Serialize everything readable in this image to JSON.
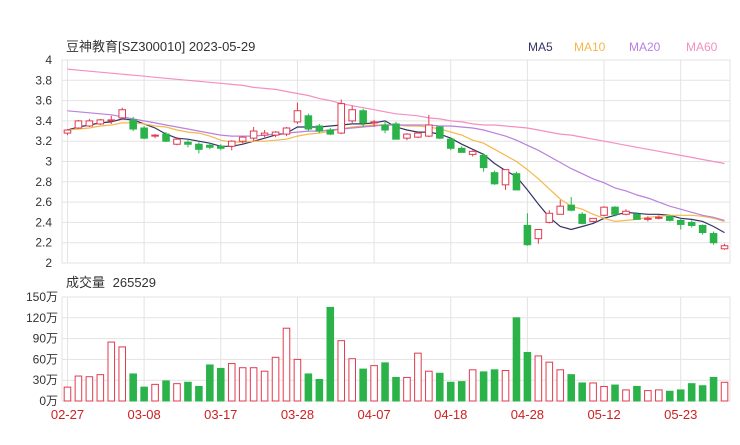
{
  "header": {
    "title": "豆神教育[SZ300010] 2023-05-29",
    "legend": [
      {
        "label": "MA5",
        "color": "#333366"
      },
      {
        "label": "MA10",
        "color": "#f5b84a"
      },
      {
        "label": "MA20",
        "color": "#b980e0"
      },
      {
        "label": "MA60",
        "color": "#f58fc0"
      }
    ]
  },
  "volume_header": {
    "label": "成交量",
    "value": "265529"
  },
  "colors": {
    "up": "#e03b4f",
    "down": "#2bb34a",
    "grid": "#e3e3e3",
    "axis": "#666666",
    "date": "#cc2222"
  },
  "chart_data": [
    {
      "type": "candlestick",
      "title": "豆神教育[SZ300010] 2023-05-29",
      "ylim": [
        2,
        4
      ],
      "y_ticks": [
        "4",
        "3.8",
        "3.6",
        "3.4",
        "3.2",
        "3",
        "2.8",
        "2.6",
        "2.4",
        "2.2",
        "2"
      ],
      "x_tick_labels": [
        "02-27",
        "03-08",
        "03-17",
        "03-28",
        "04-07",
        "04-18",
        "04-28",
        "05-12",
        "05-23"
      ],
      "x_tick_indices": [
        0,
        7,
        14,
        21,
        28,
        35,
        42,
        49,
        56
      ],
      "ohlc": [
        [
          3.28,
          3.32,
          3.26,
          3.31
        ],
        [
          3.33,
          3.41,
          3.32,
          3.4
        ],
        [
          3.35,
          3.42,
          3.34,
          3.4
        ],
        [
          3.37,
          3.42,
          3.36,
          3.41
        ],
        [
          3.4,
          3.45,
          3.37,
          3.41
        ],
        [
          3.43,
          3.53,
          3.41,
          3.51
        ],
        [
          3.41,
          3.44,
          3.3,
          3.32
        ],
        [
          3.33,
          3.35,
          3.22,
          3.23
        ],
        [
          3.25,
          3.27,
          3.23,
          3.26
        ],
        [
          3.27,
          3.29,
          3.19,
          3.2
        ],
        [
          3.17,
          3.24,
          3.16,
          3.22
        ],
        [
          3.19,
          3.21,
          3.14,
          3.17
        ],
        [
          3.17,
          3.19,
          3.08,
          3.12
        ],
        [
          3.16,
          3.18,
          3.12,
          3.14
        ],
        [
          3.15,
          3.17,
          3.11,
          3.13
        ],
        [
          3.15,
          3.21,
          3.11,
          3.2
        ],
        [
          3.2,
          3.25,
          3.18,
          3.24
        ],
        [
          3.23,
          3.34,
          3.2,
          3.3
        ],
        [
          3.26,
          3.31,
          3.24,
          3.28
        ],
        [
          3.26,
          3.3,
          3.24,
          3.29
        ],
        [
          3.27,
          3.34,
          3.25,
          3.33
        ],
        [
          3.39,
          3.58,
          3.37,
          3.5
        ],
        [
          3.45,
          3.47,
          3.3,
          3.32
        ],
        [
          3.35,
          3.37,
          3.28,
          3.3
        ],
        [
          3.31,
          3.33,
          3.26,
          3.27
        ],
        [
          3.28,
          3.61,
          3.27,
          3.57
        ],
        [
          3.4,
          3.55,
          3.38,
          3.51
        ],
        [
          3.5,
          3.52,
          3.34,
          3.38
        ],
        [
          3.38,
          3.41,
          3.34,
          3.39
        ],
        [
          3.36,
          3.4,
          3.28,
          3.31
        ],
        [
          3.37,
          3.39,
          3.22,
          3.22
        ],
        [
          3.23,
          3.28,
          3.21,
          3.27
        ],
        [
          3.24,
          3.29,
          3.23,
          3.28
        ],
        [
          3.25,
          3.46,
          3.24,
          3.36
        ],
        [
          3.34,
          3.35,
          3.22,
          3.23
        ],
        [
          3.22,
          3.24,
          3.11,
          3.13
        ],
        [
          3.13,
          3.15,
          3.09,
          3.09
        ],
        [
          3.07,
          3.11,
          3.05,
          3.1
        ],
        [
          3.06,
          3.08,
          2.9,
          2.94
        ],
        [
          2.89,
          2.91,
          2.77,
          2.78
        ],
        [
          2.77,
          2.9,
          2.72,
          2.92
        ],
        [
          2.88,
          2.9,
          2.72,
          2.72
        ],
        [
          2.37,
          2.49,
          2.17,
          2.18
        ],
        [
          2.24,
          2.32,
          2.19,
          2.33
        ],
        [
          2.4,
          2.52,
          2.39,
          2.49
        ],
        [
          2.48,
          2.62,
          2.48,
          2.56
        ],
        [
          2.57,
          2.65,
          2.51,
          2.52
        ],
        [
          2.48,
          2.5,
          2.38,
          2.39
        ],
        [
          2.41,
          2.44,
          2.4,
          2.44
        ],
        [
          2.47,
          2.56,
          2.46,
          2.55
        ],
        [
          2.55,
          2.56,
          2.46,
          2.48
        ],
        [
          2.48,
          2.53,
          2.47,
          2.51
        ],
        [
          2.48,
          2.5,
          2.43,
          2.43
        ],
        [
          2.43,
          2.46,
          2.41,
          2.44
        ],
        [
          2.45,
          2.47,
          2.43,
          2.45
        ],
        [
          2.46,
          2.47,
          2.41,
          2.42
        ],
        [
          2.42,
          2.44,
          2.33,
          2.38
        ],
        [
          2.4,
          2.42,
          2.35,
          2.37
        ],
        [
          2.37,
          2.38,
          2.28,
          2.3
        ],
        [
          2.29,
          2.31,
          2.18,
          2.2
        ],
        [
          2.14,
          2.19,
          2.13,
          2.17
        ]
      ],
      "ma5": [
        3.31,
        3.34,
        3.36,
        3.38,
        3.39,
        3.42,
        3.41,
        3.37,
        3.33,
        3.27,
        3.23,
        3.22,
        3.2,
        3.18,
        3.15,
        3.15,
        3.17,
        3.2,
        3.23,
        3.26,
        3.28,
        3.34,
        3.34,
        3.34,
        3.35,
        3.36,
        3.37,
        3.37,
        3.38,
        3.4,
        3.34,
        3.31,
        3.29,
        3.29,
        3.27,
        3.23,
        3.17,
        3.12,
        3.07,
        2.98,
        2.91,
        2.85,
        2.72,
        2.58,
        2.45,
        2.36,
        2.33,
        2.36,
        2.39,
        2.44,
        2.47,
        2.5,
        2.49,
        2.48,
        2.48,
        2.47,
        2.44,
        2.43,
        2.41,
        2.36,
        2.3
      ],
      "ma10": [
        3.31,
        3.32,
        3.33,
        3.35,
        3.36,
        3.38,
        3.38,
        3.37,
        3.35,
        3.34,
        3.31,
        3.29,
        3.28,
        3.25,
        3.21,
        3.19,
        3.19,
        3.2,
        3.2,
        3.21,
        3.22,
        3.25,
        3.27,
        3.28,
        3.3,
        3.32,
        3.34,
        3.35,
        3.36,
        3.36,
        3.36,
        3.35,
        3.35,
        3.34,
        3.32,
        3.29,
        3.26,
        3.21,
        3.18,
        3.12,
        3.06,
        3.0,
        2.92,
        2.83,
        2.73,
        2.63,
        2.56,
        2.53,
        2.48,
        2.44,
        2.41,
        2.42,
        2.43,
        2.45,
        2.46,
        2.47,
        2.47,
        2.47,
        2.46,
        2.44,
        2.41
      ],
      "ma20": [
        3.5,
        3.49,
        3.48,
        3.47,
        3.46,
        3.44,
        3.42,
        3.4,
        3.38,
        3.36,
        3.34,
        3.32,
        3.3,
        3.28,
        3.26,
        3.25,
        3.25,
        3.25,
        3.26,
        3.27,
        3.28,
        3.29,
        3.3,
        3.3,
        3.31,
        3.32,
        3.33,
        3.34,
        3.35,
        3.36,
        3.36,
        3.36,
        3.36,
        3.36,
        3.35,
        3.35,
        3.34,
        3.33,
        3.31,
        3.28,
        3.25,
        3.21,
        3.16,
        3.11,
        3.05,
        2.99,
        2.93,
        2.88,
        2.83,
        2.79,
        2.74,
        2.71,
        2.67,
        2.64,
        2.6,
        2.56,
        2.53,
        2.5,
        2.47,
        2.45,
        2.42
      ],
      "ma60": [
        3.91,
        3.9,
        3.89,
        3.88,
        3.87,
        3.86,
        3.85,
        3.84,
        3.83,
        3.82,
        3.81,
        3.8,
        3.79,
        3.78,
        3.77,
        3.76,
        3.75,
        3.73,
        3.72,
        3.71,
        3.69,
        3.67,
        3.65,
        3.62,
        3.6,
        3.57,
        3.55,
        3.53,
        3.51,
        3.49,
        3.47,
        3.46,
        3.45,
        3.43,
        3.42,
        3.4,
        3.39,
        3.37,
        3.36,
        3.36,
        3.35,
        3.34,
        3.33,
        3.31,
        3.29,
        3.27,
        3.26,
        3.24,
        3.22,
        3.2,
        3.18,
        3.16,
        3.14,
        3.12,
        3.1,
        3.08,
        3.06,
        3.04,
        3.02,
        3.0,
        2.98
      ]
    },
    {
      "type": "bar",
      "title": "成交量 265529",
      "unit": "万",
      "ylim": [
        0,
        150
      ],
      "y_ticks": [
        "150万",
        "120万",
        "90万",
        "60万",
        "30万",
        "0万"
      ],
      "y_tick_values": [
        150,
        120,
        90,
        60,
        30,
        0
      ],
      "values": [
        20,
        36,
        35,
        38,
        85,
        78,
        39,
        20,
        24,
        29,
        25,
        27,
        21,
        52,
        47,
        54,
        48,
        48,
        43,
        63,
        105,
        60,
        39,
        31,
        135,
        87,
        61,
        46,
        51,
        55,
        34,
        34,
        69,
        43,
        40,
        27,
        28,
        45,
        42,
        45,
        44,
        120,
        70,
        65,
        56,
        45,
        38,
        26,
        26,
        21,
        23,
        16,
        21,
        15,
        16,
        14,
        16,
        25,
        22,
        34,
        27
      ]
    }
  ]
}
